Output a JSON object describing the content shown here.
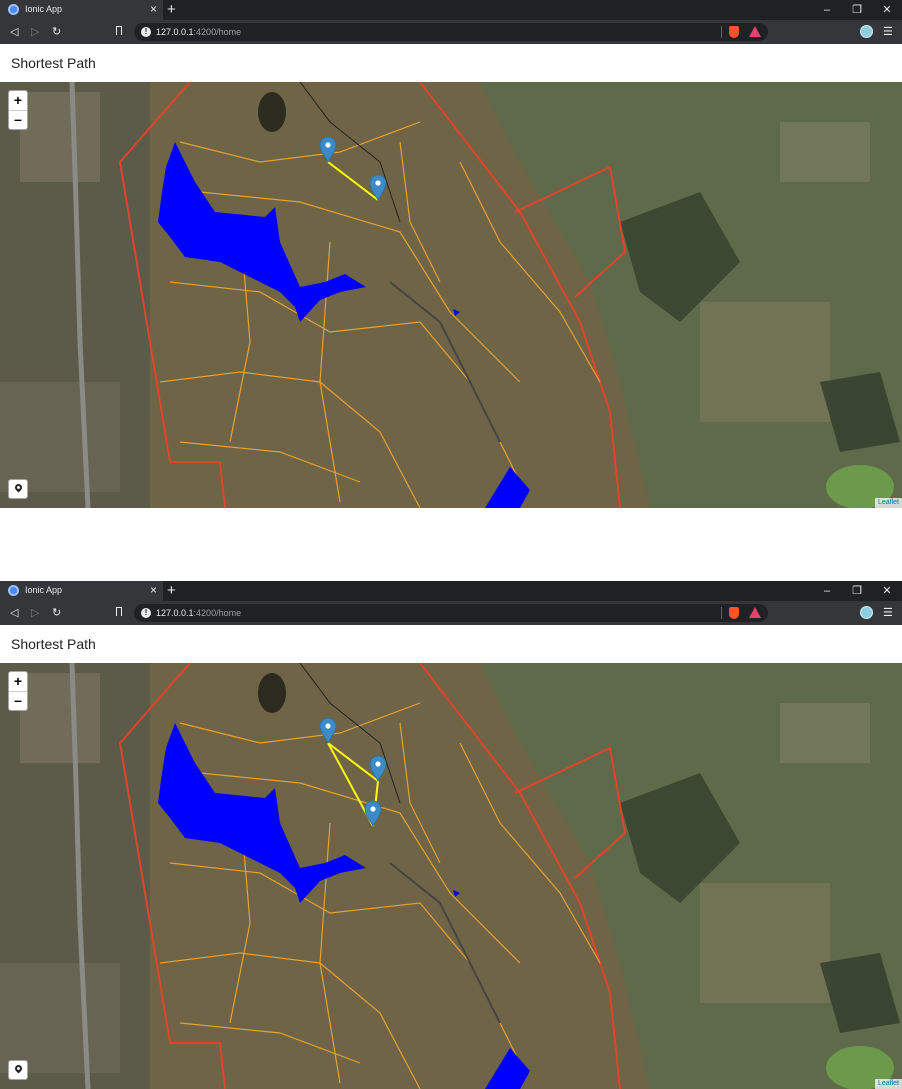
{
  "browser": {
    "tab_title": "Ionic App",
    "tab_close": "×",
    "new_tab": "+",
    "url_host": "127.0.0.1",
    "url_rest": ":4200/home",
    "window_minimize": "–",
    "window_restore": "❐",
    "window_close": "✕",
    "nav_back": "◁",
    "nav_forward": "▷",
    "nav_reload": "↻",
    "info_icon_glyph": "!",
    "menu_glyph": "☰"
  },
  "app": {
    "title": "Shortest Path"
  },
  "map": {
    "zoom_in": "+",
    "zoom_out": "–",
    "attribution": "Leaflet",
    "water_color": "#0000ff",
    "path_color": "#ffff00",
    "boundary_color": "#e0442a",
    "track_color": "#e8a030",
    "marker_color": "#3c8bc6"
  },
  "screens": [
    {
      "marker_count": 2
    },
    {
      "marker_count": 3
    }
  ]
}
